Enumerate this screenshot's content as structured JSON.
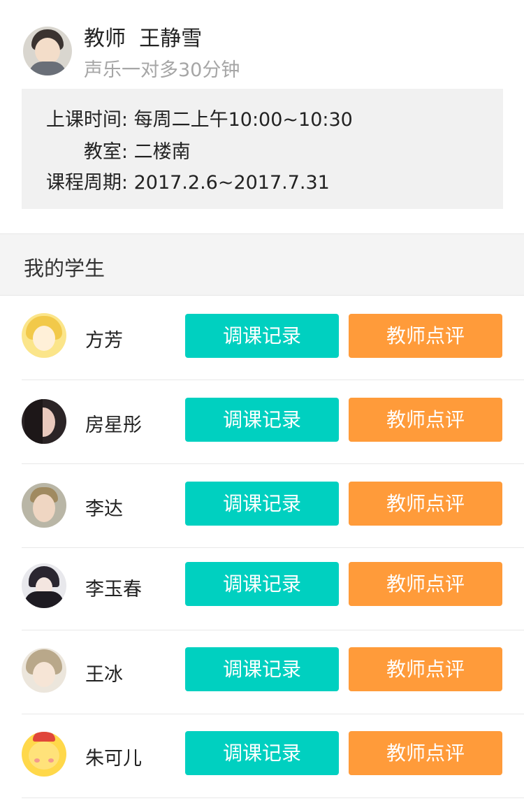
{
  "teacher": {
    "name": "教师  王静雪",
    "course": "声乐一对多30分钟"
  },
  "info": {
    "time_label": "上课时间:",
    "time_value": "每周二上午10:00~10:30",
    "room_label": "教室:",
    "room_value": "二楼南",
    "period_label": "课程周期:",
    "period_value": "2017.2.6~2017.7.31"
  },
  "section": {
    "title": "我的学生"
  },
  "buttons": {
    "record": "调课记录",
    "review": "教师点评"
  },
  "students": [
    {
      "name": "方芳"
    },
    {
      "name": "房星彤"
    },
    {
      "name": "李达"
    },
    {
      "name": "李玉春"
    },
    {
      "name": "王冰"
    },
    {
      "name": "朱可儿"
    }
  ],
  "colors": {
    "record_button": "#00d0c0",
    "review_button": "#ff9b3a"
  }
}
